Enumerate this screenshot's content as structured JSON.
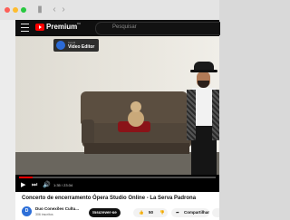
{
  "browser": {
    "window_dots": [
      "#fd5f57",
      "#febc2e",
      "#28c840"
    ],
    "icons": [
      "sidebar-icon",
      "back-icon",
      "forward-icon"
    ]
  },
  "youtube": {
    "logo_text": "Premium",
    "logo_region": "BR",
    "search_placeholder": "Pesquisar"
  },
  "player": {
    "card": {
      "small_text": "Kewl3",
      "title": "Video Editor"
    },
    "time": "1:35 / 23:34",
    "progress_fraction": 0.07
  },
  "video": {
    "title": "Concerto de encerramento Ópera Studio Online - La Serva Padrona",
    "channel_initial": "D",
    "channel_name": "Duo Conexões Cultu...",
    "subscribers": "306 inscritos",
    "subscribe_label": "Inscrever-se",
    "likes": "50",
    "share_label": "Compartilhar"
  }
}
